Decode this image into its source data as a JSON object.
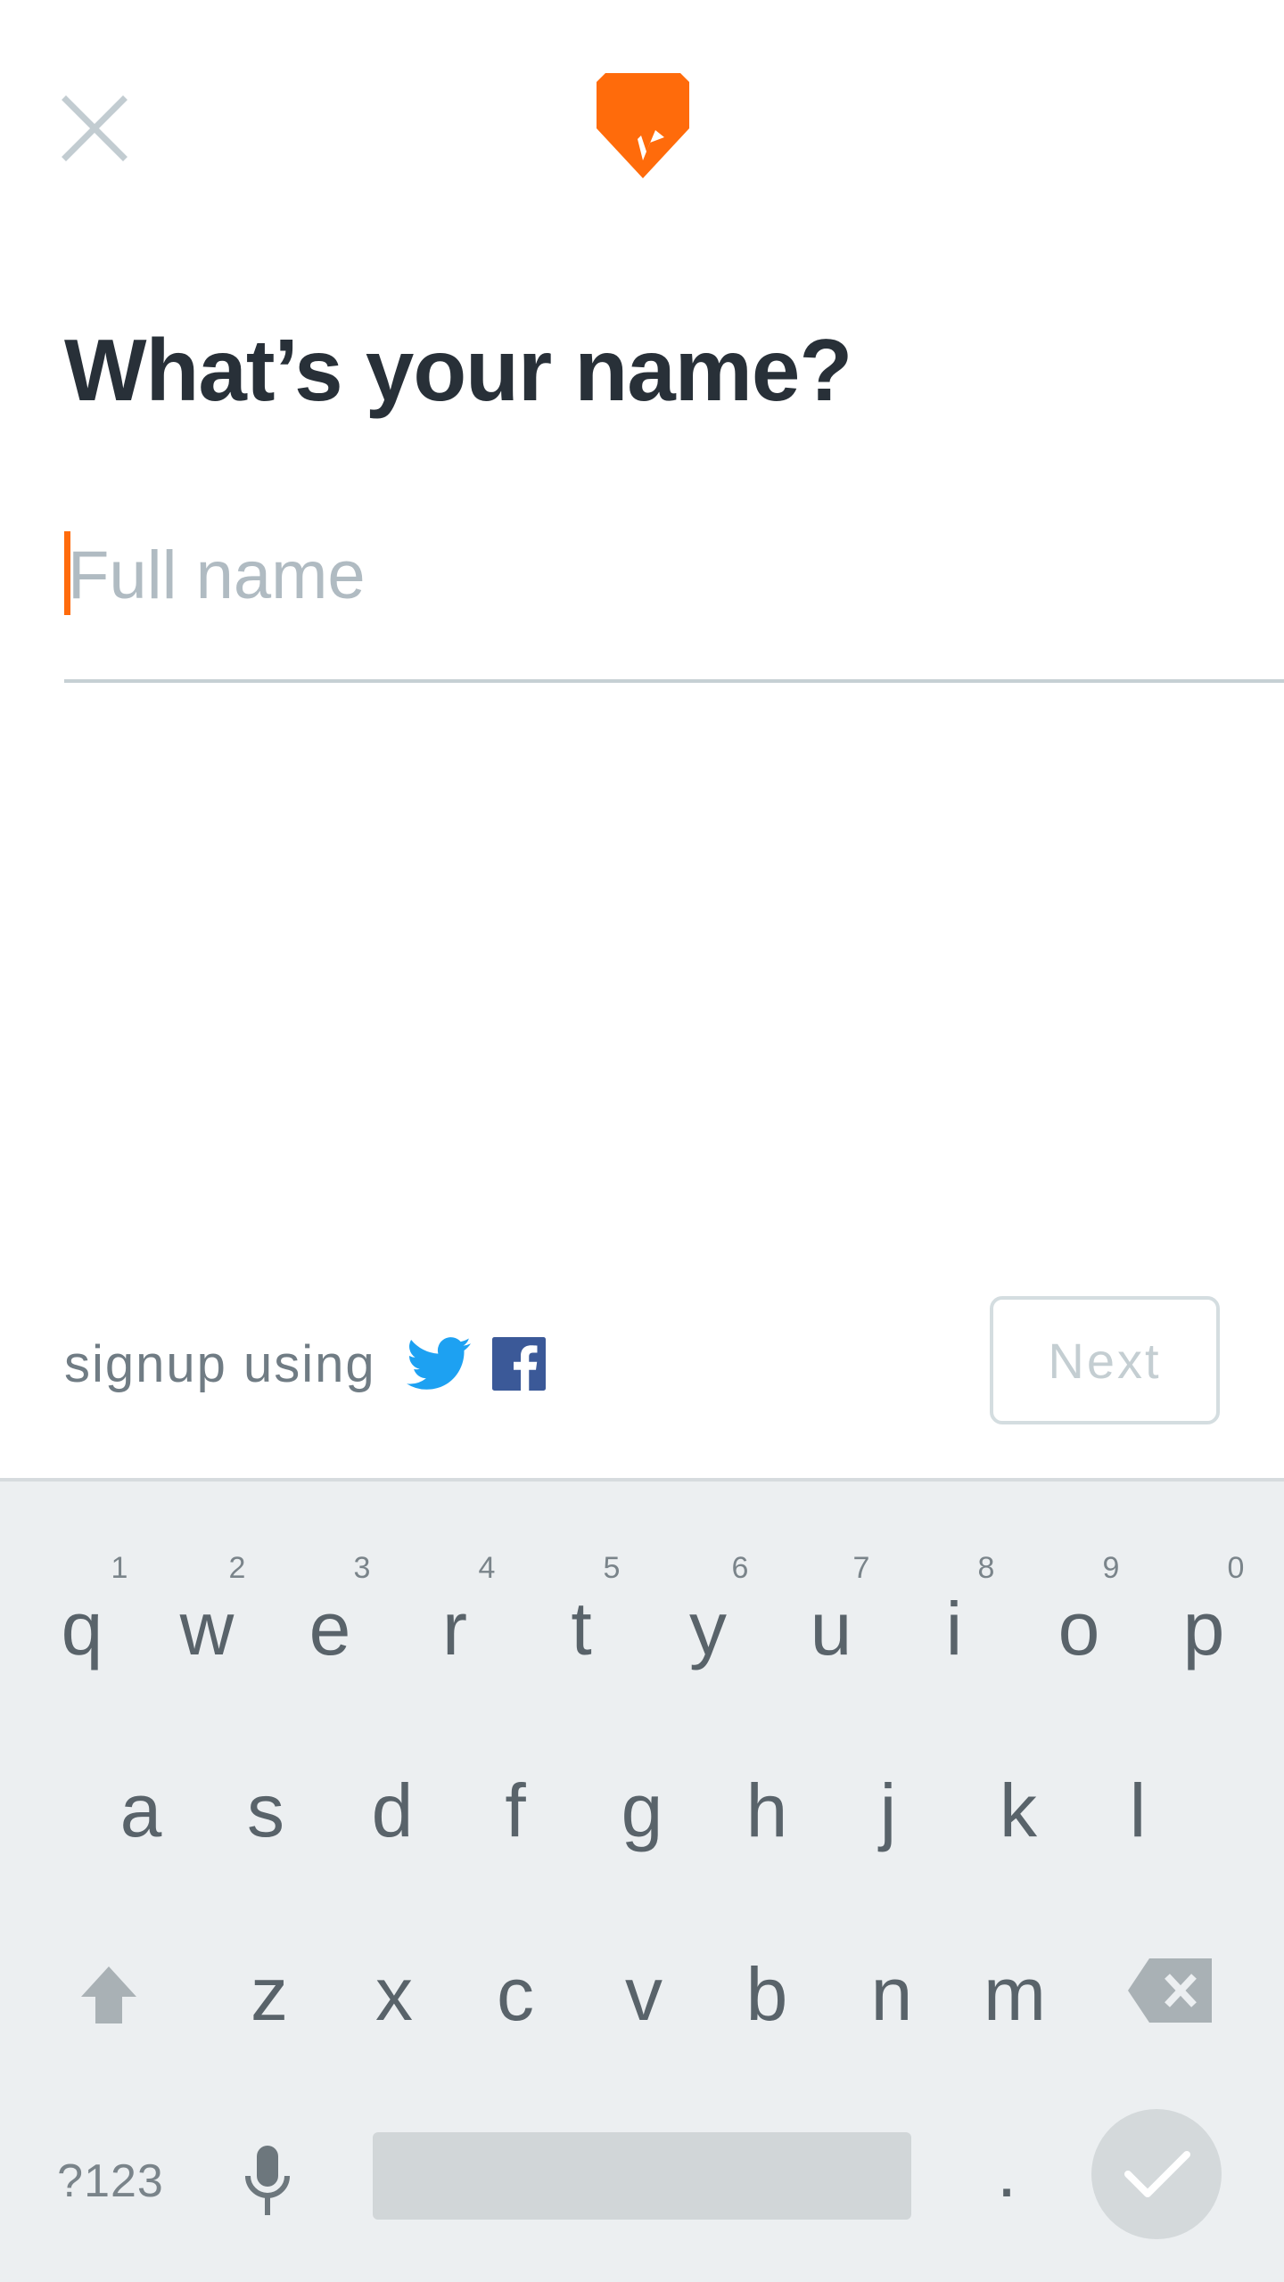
{
  "form": {
    "title": "What’s your name?",
    "name_placeholder": "Full name",
    "name_value": ""
  },
  "social": {
    "label": "signup using",
    "twitter_icon": "twitter-icon",
    "facebook_icon": "facebook-icon"
  },
  "actions": {
    "next_label": "Next"
  },
  "keyboard": {
    "row1": [
      "q",
      "w",
      "e",
      "r",
      "t",
      "y",
      "u",
      "i",
      "o",
      "p"
    ],
    "row1_hints": [
      "1",
      "2",
      "3",
      "4",
      "5",
      "6",
      "7",
      "8",
      "9",
      "0"
    ],
    "row2": [
      "a",
      "s",
      "d",
      "f",
      "g",
      "h",
      "j",
      "k",
      "l"
    ],
    "row3": [
      "z",
      "x",
      "c",
      "v",
      "b",
      "n",
      "m"
    ],
    "symbols_label": "?123",
    "period_label": "."
  },
  "colors": {
    "accent": "#ff6b0b",
    "twitter": "#1da1f2",
    "facebook": "#3b5998",
    "keyboard_bg": "#eceff1"
  }
}
